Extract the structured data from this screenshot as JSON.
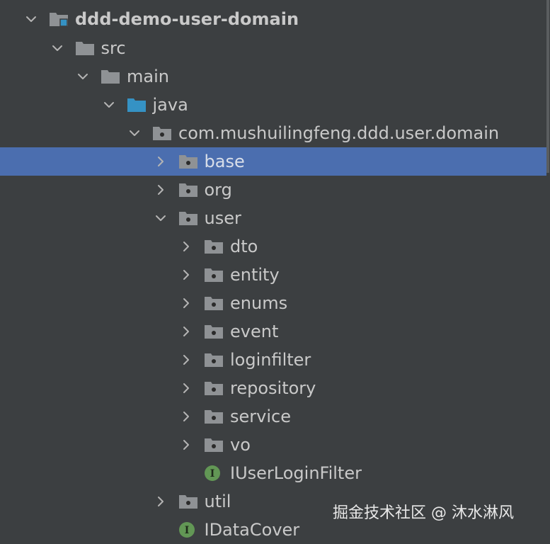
{
  "tree": {
    "rows": [
      {
        "label": "ddd-demo-user-domain",
        "icon": "module-folder-icon",
        "expanded": true,
        "bold": true
      },
      {
        "label": "src",
        "icon": "folder-icon",
        "expanded": true
      },
      {
        "label": "main",
        "icon": "folder-icon",
        "expanded": true
      },
      {
        "label": "java",
        "icon": "source-root-folder-icon",
        "expanded": true
      },
      {
        "label": "com.mushuilingfeng.ddd.user.domain",
        "icon": "package-icon",
        "expanded": true
      },
      {
        "label": "base",
        "icon": "package-icon",
        "expanded": false,
        "selected": true
      },
      {
        "label": "org",
        "icon": "package-icon",
        "expanded": false
      },
      {
        "label": "user",
        "icon": "package-icon",
        "expanded": true
      },
      {
        "label": "dto",
        "icon": "package-icon",
        "expanded": false
      },
      {
        "label": "entity",
        "icon": "package-icon",
        "expanded": false
      },
      {
        "label": "enums",
        "icon": "package-icon",
        "expanded": false
      },
      {
        "label": "event",
        "icon": "package-icon",
        "expanded": false
      },
      {
        "label": "loginfilter",
        "icon": "package-icon",
        "expanded": false
      },
      {
        "label": "repository",
        "icon": "package-icon",
        "expanded": false
      },
      {
        "label": "service",
        "icon": "package-icon",
        "expanded": false
      },
      {
        "label": "vo",
        "icon": "package-icon",
        "expanded": false
      },
      {
        "label": "IUserLoginFilter",
        "icon": "interface-icon",
        "interface_letter": "I"
      },
      {
        "label": "util",
        "icon": "package-icon",
        "expanded": false
      },
      {
        "label": "IDataCover",
        "icon": "interface-icon",
        "interface_letter": "I"
      }
    ]
  },
  "watermark": "掘金技术社区 @ 沐水淋风",
  "colors": {
    "background": "#3c3f41",
    "selection": "#4b6eaf",
    "folder": "#8f9295",
    "source_root": "#3592c4",
    "interface_badge": "#629755"
  }
}
